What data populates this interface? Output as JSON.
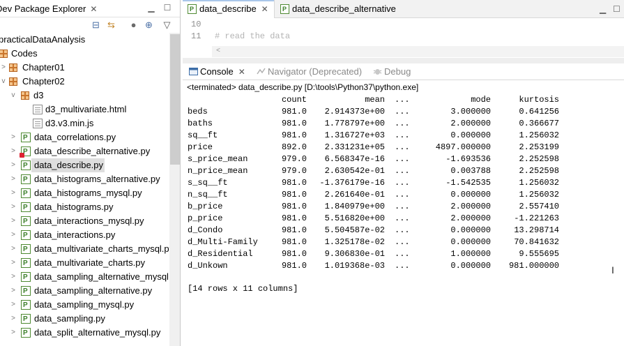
{
  "package_explorer": {
    "tab_label": "Dev Package Explorer",
    "tree": [
      {
        "label": "practicalDataAnalysis",
        "type": "project"
      },
      {
        "label": "Codes",
        "type": "package"
      },
      {
        "label": "Chapter01",
        "type": "package"
      },
      {
        "label": "Chapter02",
        "type": "package"
      },
      {
        "label": "d3",
        "type": "package"
      },
      {
        "label": "d3_multivariate.html",
        "type": "file"
      },
      {
        "label": "d3.v3.min.js",
        "type": "file"
      },
      {
        "label": "data_correlations.py",
        "type": "py"
      },
      {
        "label": "data_describe_alternative.py",
        "type": "py"
      },
      {
        "label": "data_describe.py",
        "type": "py"
      },
      {
        "label": "data_histograms_alternative.py",
        "type": "py"
      },
      {
        "label": "data_histograms_mysql.py",
        "type": "py"
      },
      {
        "label": "data_histograms.py",
        "type": "py"
      },
      {
        "label": "data_interactions_mysql.py",
        "type": "py"
      },
      {
        "label": "data_interactions.py",
        "type": "py"
      },
      {
        "label": "data_multivariate_charts_mysql.py",
        "type": "py"
      },
      {
        "label": "data_multivariate_charts.py",
        "type": "py"
      },
      {
        "label": "data_sampling_alternative_mysql.",
        "type": "py"
      },
      {
        "label": "data_sampling_alternative.py",
        "type": "py"
      },
      {
        "label": "data_sampling_mysql.py",
        "type": "py"
      },
      {
        "label": "data_sampling.py",
        "type": "py"
      },
      {
        "label": "data_split_alternative_mysql.py",
        "type": "py"
      }
    ],
    "selected_label": "data_describe.py"
  },
  "editor": {
    "tabs": [
      {
        "label": "data_describe"
      },
      {
        "label": "data_describe_alternative"
      }
    ],
    "lines": [
      {
        "number": "10",
        "text": ""
      },
      {
        "number": "11",
        "text": "# read the data"
      }
    ]
  },
  "console": {
    "tabs": [
      {
        "label": "Console"
      },
      {
        "label": "Navigator (Deprecated)"
      },
      {
        "label": "Debug"
      }
    ],
    "status": "<terminated> data_describe.py [D:\\tools\\Python37\\python.exe]",
    "header": {
      "count": "count",
      "mean": "mean",
      "dots": "...",
      "mode": "mode",
      "kurtosis": "kurtosis"
    },
    "rows": [
      {
        "name": "beds",
        "count": "981.0",
        "mean": "2.914373e+00",
        "dots": "...",
        "mode": "3.000000",
        "kurtosis": "0.641256"
      },
      {
        "name": "baths",
        "count": "981.0",
        "mean": "1.778797e+00",
        "dots": "...",
        "mode": "2.000000",
        "kurtosis": "0.366677"
      },
      {
        "name": "sq__ft",
        "count": "981.0",
        "mean": "1.316727e+03",
        "dots": "...",
        "mode": "0.000000",
        "kurtosis": "1.256032"
      },
      {
        "name": "price",
        "count": "892.0",
        "mean": "2.331231e+05",
        "dots": "...",
        "mode": "4897.000000",
        "kurtosis": "2.253199"
      },
      {
        "name": "s_price_mean",
        "count": "979.0",
        "mean": "6.568347e-16",
        "dots": "...",
        "mode": "-1.693536",
        "kurtosis": "2.252598"
      },
      {
        "name": "n_price_mean",
        "count": "979.0",
        "mean": "2.630542e-01",
        "dots": "...",
        "mode": "0.003788",
        "kurtosis": "2.252598"
      },
      {
        "name": "s_sq__ft",
        "count": "981.0",
        "mean": "-1.376179e-16",
        "dots": "...",
        "mode": "-1.542535",
        "kurtosis": "1.256032"
      },
      {
        "name": "n_sq__ft",
        "count": "981.0",
        "mean": "2.261640e-01",
        "dots": "...",
        "mode": "0.000000",
        "kurtosis": "1.256032"
      },
      {
        "name": "b_price",
        "count": "981.0",
        "mean": "1.840979e+00",
        "dots": "...",
        "mode": "2.000000",
        "kurtosis": "2.557410"
      },
      {
        "name": "p_price",
        "count": "981.0",
        "mean": "5.516820e+00",
        "dots": "...",
        "mode": "2.000000",
        "kurtosis": "-1.221263"
      },
      {
        "name": "d_Condo",
        "count": "981.0",
        "mean": "5.504587e-02",
        "dots": "...",
        "mode": "0.000000",
        "kurtosis": "13.298714"
      },
      {
        "name": "d_Multi-Family",
        "count": "981.0",
        "mean": "1.325178e-02",
        "dots": "...",
        "mode": "0.000000",
        "kurtosis": "70.841632"
      },
      {
        "name": "d_Residential",
        "count": "981.0",
        "mean": "9.306830e-01",
        "dots": "...",
        "mode": "1.000000",
        "kurtosis": "9.555695"
      },
      {
        "name": "d_Unkown",
        "count": "981.0",
        "mean": "1.019368e-03",
        "dots": "...",
        "mode": "0.000000",
        "kurtosis": "981.000000"
      }
    ],
    "footer": "[14 rows x 11 columns]"
  },
  "icons": {
    "close": "close-icon",
    "minimize": "minimize-icon",
    "maximize": "maximize-icon",
    "collapse_all": "collapse-all-icon",
    "link_editor": "link-with-editor-icon",
    "view_menu": "view-menu-icon"
  },
  "colors": {
    "selection": "#dedede",
    "active_tab_accent": "#a9c7ea",
    "comment": "#b4b4b4",
    "line_number": "#8f8f8f"
  }
}
